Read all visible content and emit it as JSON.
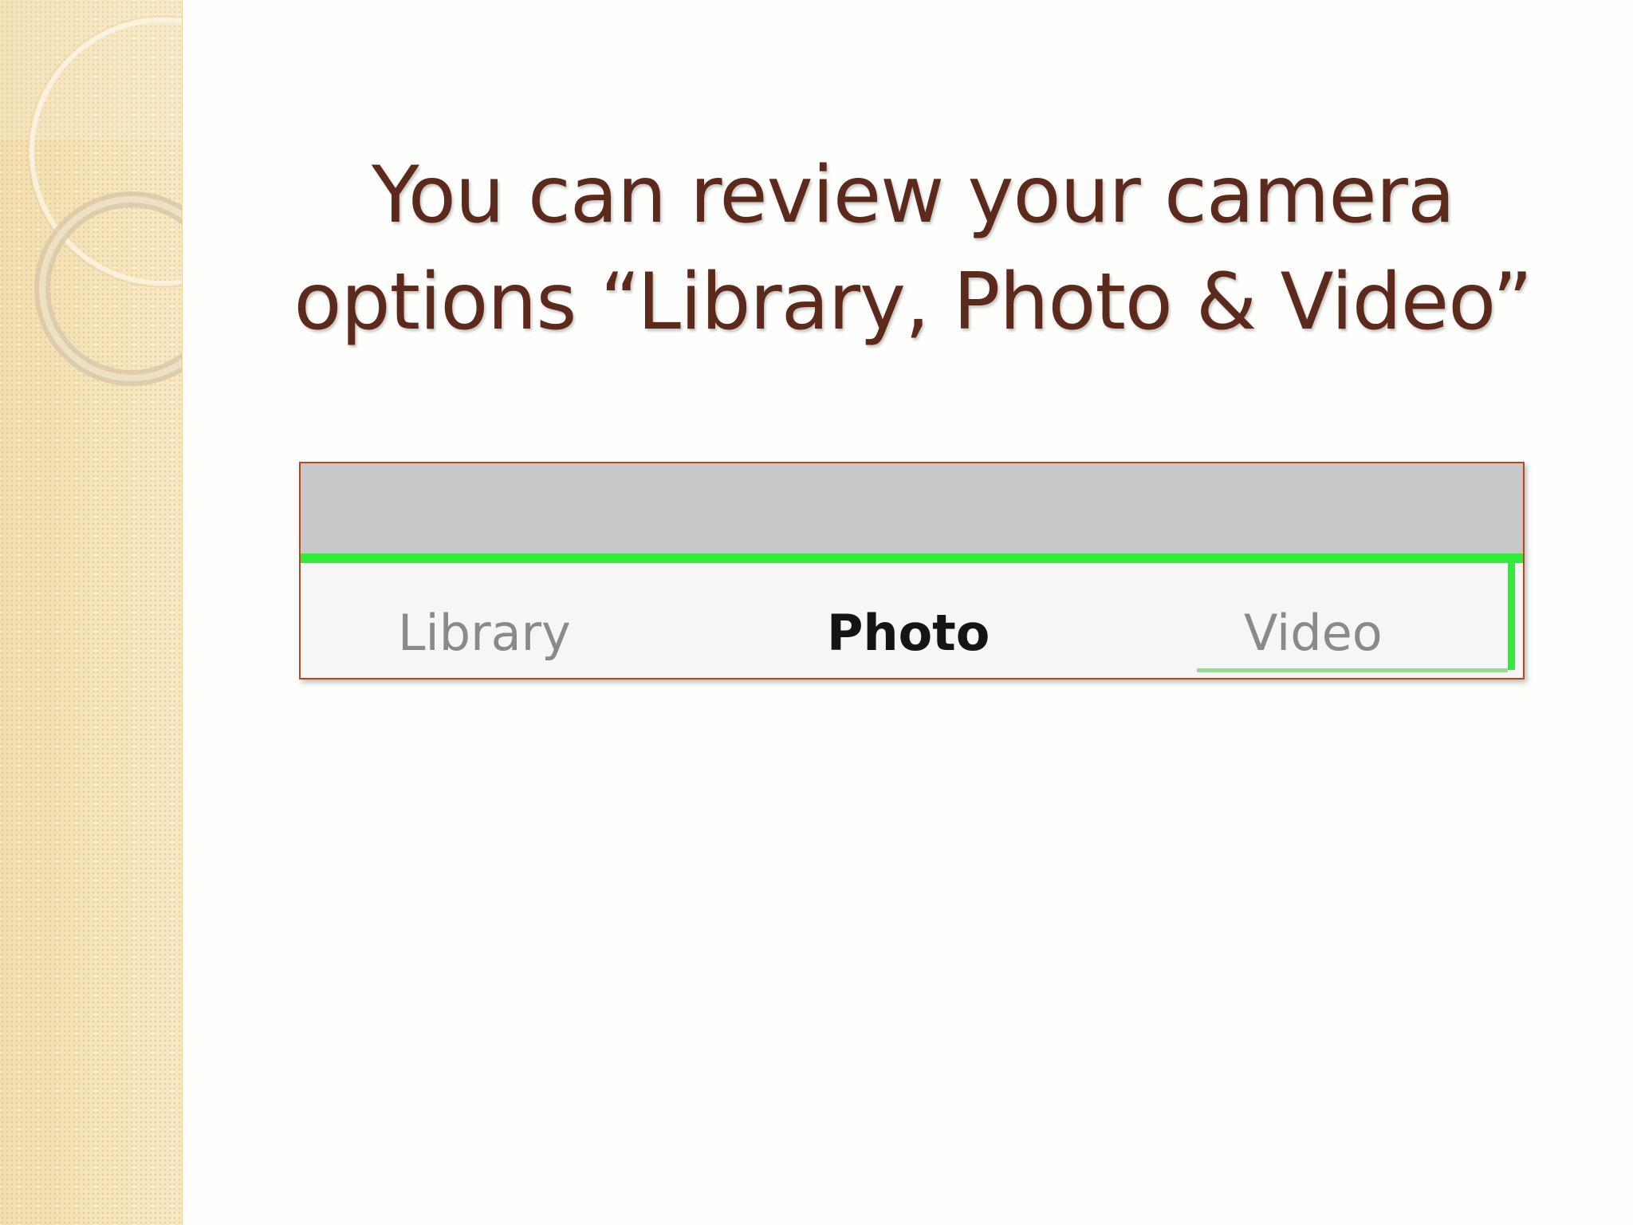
{
  "slide": {
    "title_line1": "You can review your camera",
    "title_line2": "options “Library, Photo & Video”"
  },
  "camera_modes": {
    "tabs": [
      {
        "label": "Library",
        "state": "inactive"
      },
      {
        "label": "Photo",
        "state": "selected"
      },
      {
        "label": "Video",
        "state": "inactive"
      }
    ],
    "highlight_color": "#31ea39"
  },
  "colors": {
    "title": "#5b2a1c",
    "frame_border": "#b24a1c",
    "side_panel": "#f5e4b8",
    "top_bar": "#c8c7ca"
  }
}
